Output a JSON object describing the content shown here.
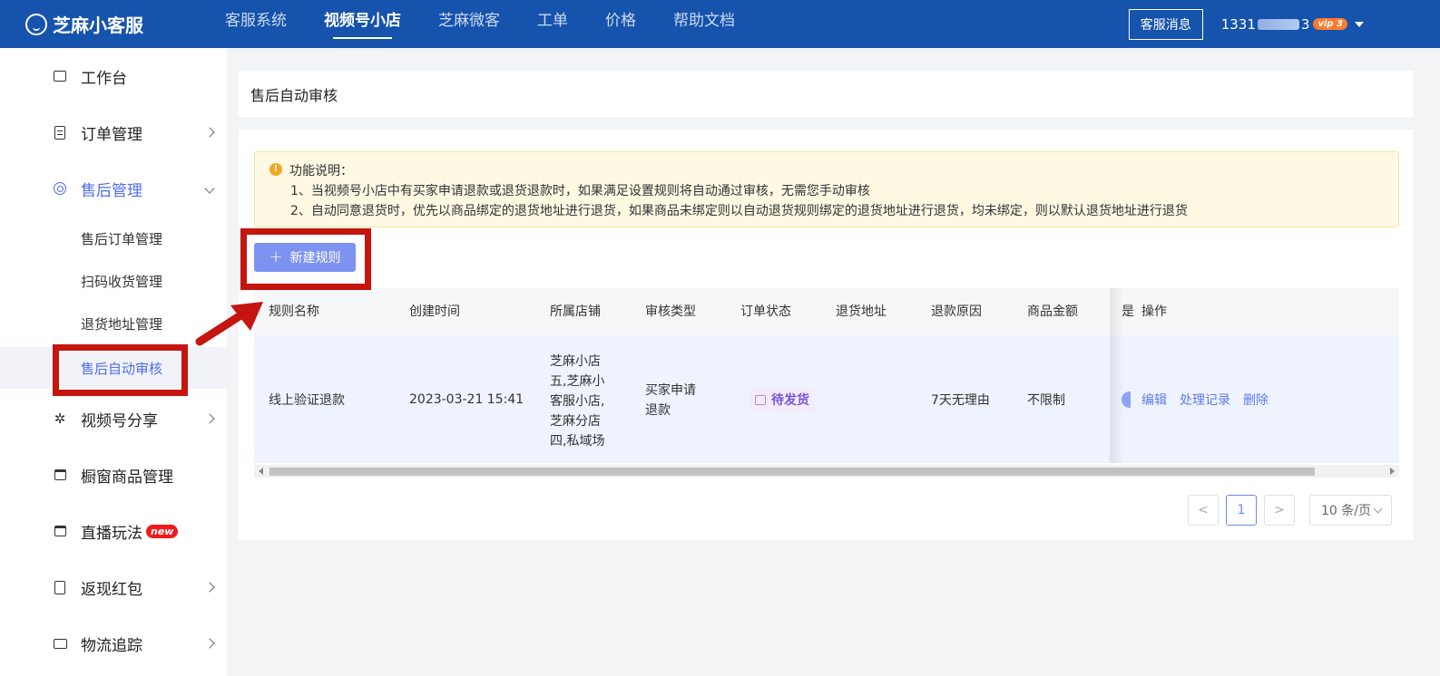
{
  "brand": {
    "name": "芝麻小客服"
  },
  "topnav": {
    "items": [
      {
        "label": "客服系统",
        "active": false
      },
      {
        "label": "视频号小店",
        "active": true
      },
      {
        "label": "芝麻微客",
        "active": false
      },
      {
        "label": "工单",
        "active": false
      },
      {
        "label": "价格",
        "active": false
      },
      {
        "label": "帮助文档",
        "active": false
      }
    ],
    "message_button": "客服消息",
    "user_prefix": "1331",
    "user_suffix": "3",
    "vip_badge": "vip",
    "vip_level": "3"
  },
  "sidebar": {
    "workbench": "工作台",
    "orders": "订单管理",
    "after_sales": "售后管理",
    "after_sales_sub": [
      "售后订单管理",
      "扫码收货管理",
      "退货地址管理",
      "售后自动审核"
    ],
    "share": "视频号分享",
    "showcase": "橱窗商品管理",
    "live": "直播玩法",
    "live_badge": "new",
    "cashback": "返现红包",
    "logistics": "物流追踪"
  },
  "page": {
    "title": "售后自动审核",
    "notice_title": "功能说明：",
    "notice_lines": [
      "1、当视频号小店中有买家申请退款或退货退款时，如果满足设置规则将自动通过审核，无需您手动审核",
      "2、自动同意退货时，优先以商品绑定的退货地址进行退货，如果商品未绑定则以自动退货规则绑定的退货地址进行退货，均未绑定，则以默认退货地址进行退货"
    ],
    "new_rule_button": "新建规则"
  },
  "table": {
    "headers": [
      "规则名称",
      "创建时间",
      "所属店铺",
      "审核类型",
      "订单状态",
      "退货地址",
      "退款原因",
      "商品金额",
      "是",
      "操作"
    ],
    "row": {
      "name": "线上验证退款",
      "created": "2023-03-21 15:41",
      "shops": [
        "芝麻小店",
        "五,芝麻小",
        "客服小店,",
        "芝麻分店",
        "四,私域场"
      ],
      "audit_type": [
        "买家申请",
        "退款"
      ],
      "order_status": "待发货",
      "return_address": "",
      "reason": "7天无理由",
      "amount": "不限制",
      "ops": [
        "编辑",
        "处理记录",
        "删除"
      ]
    }
  },
  "pagination": {
    "prev": "<",
    "current": "1",
    "next": ">",
    "page_size": "10 条/页"
  },
  "colors": {
    "topbar": "#1553ad",
    "accent": "#4e6cf0",
    "button": "#7e93f1",
    "annotation": "#c4150f"
  }
}
